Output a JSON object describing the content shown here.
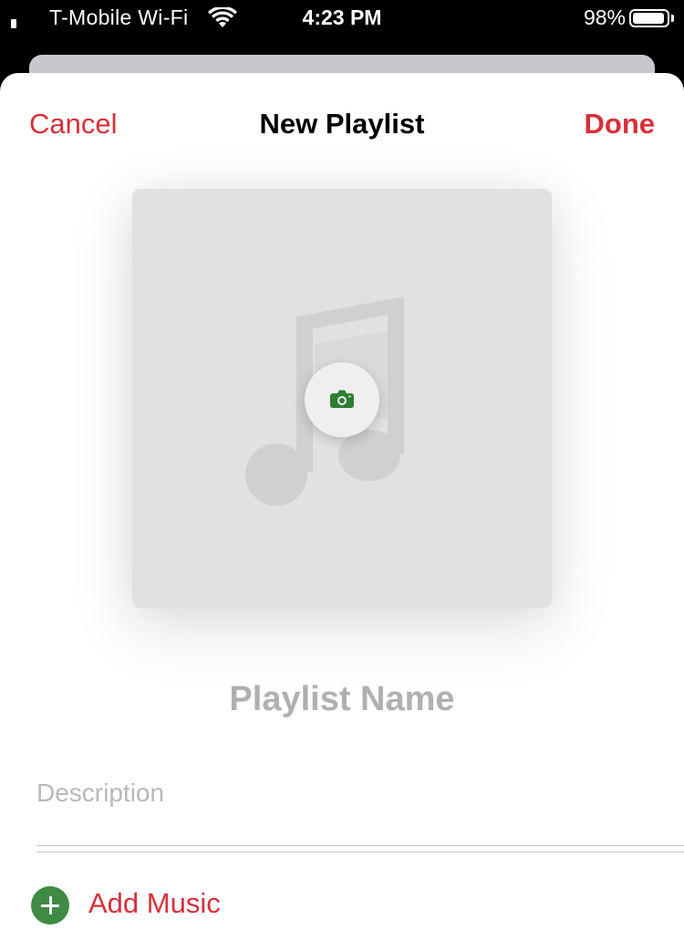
{
  "status_bar": {
    "carrier": "T-Mobile Wi-Fi",
    "time": "4:23 PM",
    "battery_percent": "98%",
    "battery_level": 0.98
  },
  "nav": {
    "cancel_label": "Cancel",
    "title": "New Playlist",
    "done_label": "Done"
  },
  "artwork": {
    "placeholder_icon": "music-note-icon",
    "camera_icon": "camera-icon"
  },
  "form": {
    "name_placeholder": "Playlist Name",
    "description_placeholder": "Description"
  },
  "actions": {
    "add_music_label": "Add Music"
  },
  "colors": {
    "accent": "#d6303a",
    "add_icon_green": "#3f8a45",
    "camera_green": "#2e7d32"
  }
}
